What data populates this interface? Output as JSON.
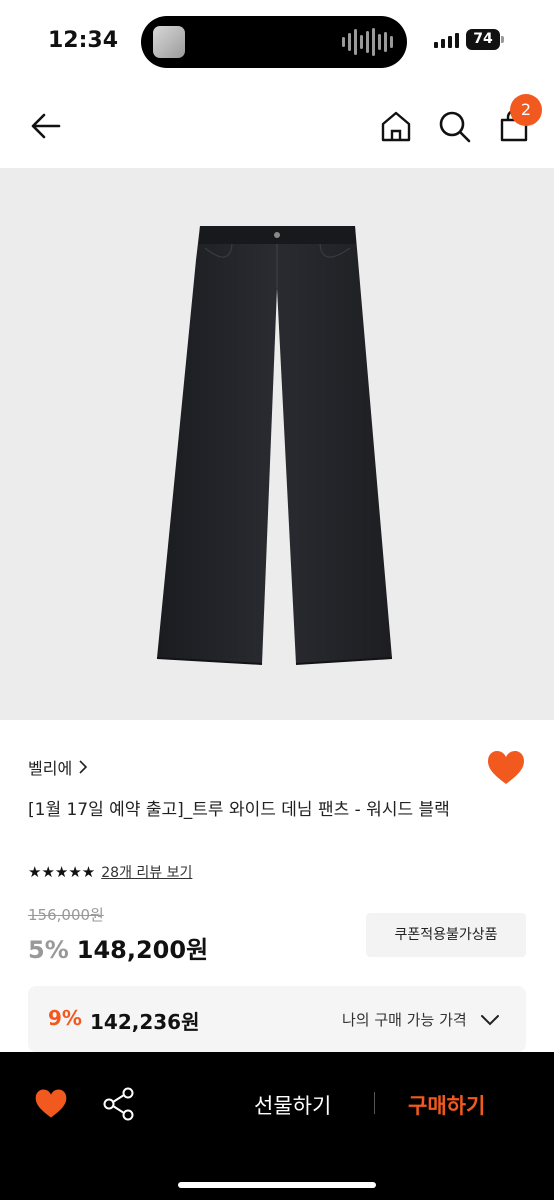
{
  "status": {
    "time": "12:34",
    "battery": "74"
  },
  "nav": {
    "cart_count": "2"
  },
  "product": {
    "brand": "벨리에",
    "title": "[1월 17일 예약 출고]_트루 와이드 데님 팬츠 - 워시드 블랙",
    "rating": 5,
    "stars": "★★★★★",
    "review_link": "28개 리뷰 보기",
    "original_price": "156,000원",
    "discount_rate": "5%",
    "sale_price": "148,200원",
    "coupon_badge": "쿠폰적용불가상품",
    "my_price": {
      "rate": "9%",
      "price": "142,236원",
      "label": "나의 구매 가능 가격"
    }
  },
  "bottom": {
    "gift_label": "선물하기",
    "buy_label": "구매하기"
  },
  "colors": {
    "accent": "#f2591f",
    "image_bg": "#ececec",
    "bottom_bg": "#000000",
    "denim": "#232428"
  }
}
